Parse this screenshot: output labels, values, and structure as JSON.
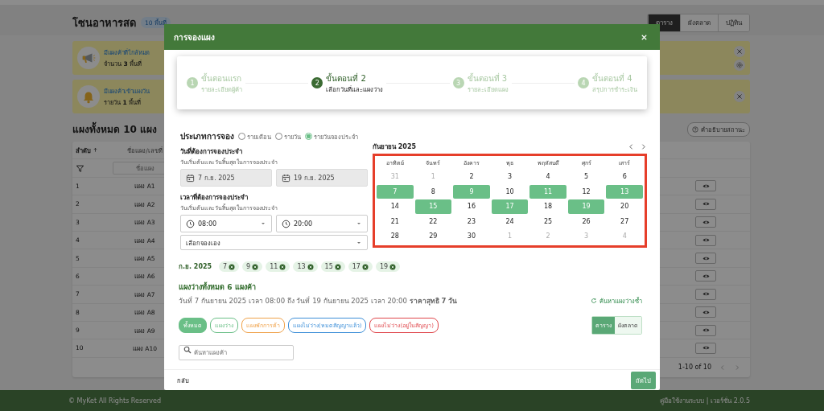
{
  "page": {
    "title": "โซนอาหารสด",
    "badge": "10 พื้นที่",
    "view_tabs": [
      {
        "label": "ตาราง",
        "selected": true
      },
      {
        "label": "ผังตลาด",
        "selected": false
      },
      {
        "label": "ปฏิทิน",
        "selected": false
      }
    ],
    "alerts": [
      {
        "kind": "megaphone",
        "title": "มีแผงค้าที่ใกล้หมด",
        "text": "จำนวน **3** พื้นที่",
        "settings": true
      },
      {
        "kind": "bell",
        "title": "มีแผงค้าเข้าแผงวัน",
        "text": "รายวัน **1** พื้นที่",
        "settings": false
      }
    ],
    "list_title": "แผงทั้งหมด 10 แผง",
    "status_help": "คำอธิบายสถานะ",
    "table": {
      "columns": [
        "ลำดับ",
        "ชื่อแผง/เลขที่"
      ],
      "filter_placeholder": "ชื่อแผง",
      "rows": [
        {
          "no": "1",
          "name": "แผง A1"
        },
        {
          "no": "2",
          "name": "แผง A2"
        },
        {
          "no": "3",
          "name": "แผง A3"
        },
        {
          "no": "4",
          "name": "แผง A4"
        },
        {
          "no": "5",
          "name": "แผง A5"
        },
        {
          "no": "6",
          "name": "แผง A6"
        },
        {
          "no": "7",
          "name": "แผง A7"
        },
        {
          "no": "8",
          "name": "แผง A8"
        },
        {
          "no": "9",
          "name": "แผง A9"
        },
        {
          "no": "10",
          "name": "แผง A10"
        }
      ],
      "pagination": "1-10 of 10"
    },
    "footer": {
      "copyright": "© MyKet All Rights Reserved",
      "info": "คู่มือใช้งานระบบ | เวอร์ชั่น 2.0.5"
    }
  },
  "modal": {
    "title": "การจองแผง",
    "steps": [
      {
        "number": "1",
        "title": "ขั้นตอนแรก",
        "subtitle": "รายละเอียดผู้ค้า",
        "selected": false
      },
      {
        "number": "2",
        "title": "ขั้นตอนที่ 2",
        "subtitle": "เลือกวันที่และแผงว่าง",
        "selected": true
      },
      {
        "number": "3",
        "title": "ขั้นตอนที่ 3",
        "subtitle": "รายละเอียดแผง",
        "selected": false
      },
      {
        "number": "4",
        "title": "ขั้นตอนที่ 4",
        "subtitle": "สรุปการชำระเงิน",
        "selected": false
      }
    ],
    "booking_type": {
      "label": "ประเภทการจอง",
      "options": [
        {
          "label": "รายเดือน",
          "selected": false
        },
        {
          "label": "รายวัน",
          "selected": false
        },
        {
          "label": "รายวันจองประจำ",
          "selected": true
        }
      ]
    },
    "dates": {
      "title": "วันที่ต้องการจองประจำ",
      "hint": "วันเริ่มต้นและวันสิ้นสุดในการจองประจำ",
      "start": "7 ก.ย. 2025",
      "end": "19 ก.ย. 2025"
    },
    "times": {
      "title": "เวลาที่ต้องการจองประจำ",
      "hint": "วันเริ่มต้นและวันสิ้นสุดในการจองประจำ",
      "start": "08:00",
      "end": "20:00",
      "mode": "เลือกจองเอง"
    },
    "calendar": {
      "month": "กันยายน 2025",
      "weekdays": [
        "อาทิตย์",
        "จันทร์",
        "อังคาร",
        "พุธ",
        "พฤหัสบดี",
        "ศุกร์",
        "เสาร์"
      ],
      "days": [
        {
          "label": "31",
          "outside": true,
          "selected": false
        },
        {
          "label": "1",
          "outside": true,
          "selected": false
        },
        {
          "label": "2",
          "outside": false,
          "selected": false
        },
        {
          "label": "3",
          "outside": false,
          "selected": false
        },
        {
          "label": "4",
          "outside": false,
          "selected": false
        },
        {
          "label": "5",
          "outside": false,
          "selected": false
        },
        {
          "label": "6",
          "outside": false,
          "selected": false
        },
        {
          "label": "7",
          "outside": false,
          "selected": true
        },
        {
          "label": "8",
          "outside": false,
          "selected": false
        },
        {
          "label": "9",
          "outside": false,
          "selected": true
        },
        {
          "label": "10",
          "outside": false,
          "selected": false
        },
        {
          "label": "11",
          "outside": false,
          "selected": true
        },
        {
          "label": "12",
          "outside": false,
          "selected": false
        },
        {
          "label": "13",
          "outside": false,
          "selected": true
        },
        {
          "label": "14",
          "outside": false,
          "selected": false
        },
        {
          "label": "15",
          "outside": false,
          "selected": true
        },
        {
          "label": "16",
          "outside": false,
          "selected": false
        },
        {
          "label": "17",
          "outside": false,
          "selected": true
        },
        {
          "label": "18",
          "outside": false,
          "selected": false
        },
        {
          "label": "19",
          "outside": false,
          "selected": true
        },
        {
          "label": "20",
          "outside": false,
          "selected": false
        },
        {
          "label": "21",
          "outside": false,
          "selected": false
        },
        {
          "label": "22",
          "outside": false,
          "selected": false
        },
        {
          "label": "23",
          "outside": false,
          "selected": false
        },
        {
          "label": "24",
          "outside": false,
          "selected": false
        },
        {
          "label": "25",
          "outside": false,
          "selected": false
        },
        {
          "label": "26",
          "outside": false,
          "selected": false
        },
        {
          "label": "27",
          "outside": false,
          "selected": false
        },
        {
          "label": "28",
          "outside": false,
          "selected": false
        },
        {
          "label": "29",
          "outside": false,
          "selected": false
        },
        {
          "label": "30",
          "outside": false,
          "selected": false
        },
        {
          "label": "1",
          "outside": true,
          "selected": false
        },
        {
          "label": "2",
          "outside": true,
          "selected": false
        },
        {
          "label": "3",
          "outside": true,
          "selected": false
        },
        {
          "label": "4",
          "outside": true,
          "selected": false
        }
      ]
    },
    "chosen": {
      "month": "ก.ย. 2025",
      "days": [
        "7",
        "9",
        "11",
        "13",
        "15",
        "17",
        "19"
      ]
    },
    "results": {
      "title": "แผงว่างทั้งหมด 6 แผงค้า",
      "summary": "วันที่ 7 กันยายน 2025 เวลา 08:00 ถึง วันที่ 19 กันยายน 2025 เวลา 20:00 **ราคาสุทธิ 7 วัน**",
      "refresh": "ค้นหาแผงว่างซ้ำ",
      "filters": [
        {
          "label": "ทั้งหมด",
          "color": "#6abf87",
          "selected": true
        },
        {
          "label": "แผงว่าง",
          "color": "#6abf87",
          "selected": false
        },
        {
          "label": "แผงพักการค้า",
          "color": "#f0a24a",
          "selected": false
        },
        {
          "label": "แผงไม่ว่าง(หมดสัญญาแล้ว)",
          "color": "#3d8fd8",
          "selected": false
        },
        {
          "label": "แผงไม่ว่าง(อยู่ในสัญญา)",
          "color": "#e0474c",
          "selected": false
        }
      ],
      "views": [
        {
          "label": "ตาราง",
          "selected": true
        },
        {
          "label": "ผังตลาด",
          "selected": false
        }
      ],
      "search_placeholder": "ค้นหาแผงค้า"
    },
    "back": "กลับ",
    "next": "ถัดไป"
  }
}
